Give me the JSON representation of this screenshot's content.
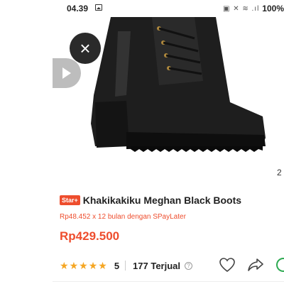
{
  "status_bar": {
    "time": "04.39",
    "battery": "100%"
  },
  "product": {
    "badge": "Star+",
    "title": "Khakikakiku Meghan Black Boots",
    "installment": "Rp48.452 x 12 bulan dengan SPayLater",
    "price": "Rp429.500",
    "rating": "5",
    "sold": "177 Terjual",
    "image_index": "2"
  },
  "icons": {
    "close": "close-icon",
    "play": "play-icon",
    "favorite": "heart-icon",
    "share": "share-icon",
    "chat": "chat-icon",
    "help": "help-icon"
  },
  "colors": {
    "accent": "#ee4d2d",
    "star": "#f5a623"
  }
}
